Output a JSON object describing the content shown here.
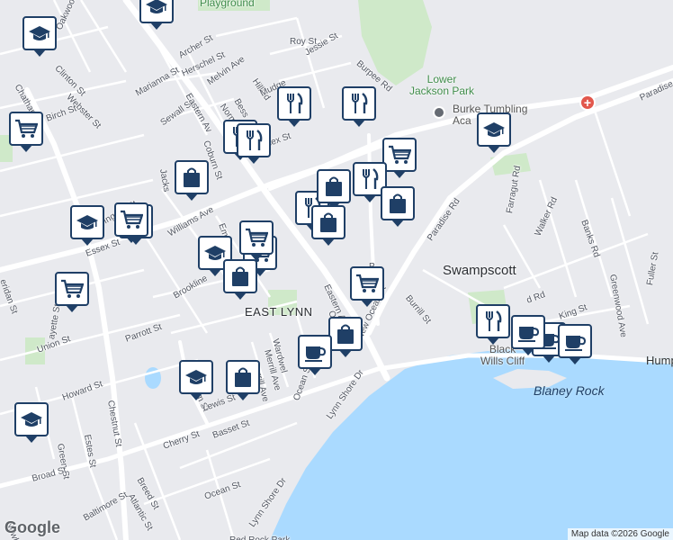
{
  "map": {
    "colors": {
      "land": "#e9eaee",
      "road": "#ffffff",
      "park": "#cfe9c9",
      "water": "#aadaff",
      "pin_border": "#1f3f66"
    },
    "places": [
      {
        "id": "swampscott",
        "text": "Swampscott"
      },
      {
        "id": "east-lynn",
        "text": "EAST LYNN"
      }
    ],
    "parks": [
      {
        "id": "playground",
        "text": "Playground"
      },
      {
        "id": "lower-jackson-park",
        "text": "Lower\nJackson Park"
      },
      {
        "id": "black-wills-cliff",
        "text": "Black\nWills Cliff"
      }
    ],
    "poi": [
      {
        "id": "burke-tumbling",
        "text": "Burke Tumbling\nAca"
      }
    ],
    "water_labels": [
      {
        "id": "blaney-rock",
        "text": "Blaney Rock"
      },
      {
        "id": "humphrey",
        "text": "Hump"
      }
    ],
    "streets": [
      {
        "id": "oakwood",
        "text": "Oakwood Av"
      },
      {
        "id": "clinton",
        "text": "Clinton St"
      },
      {
        "id": "webster",
        "text": "Webster St"
      },
      {
        "id": "birch",
        "text": "Birch St"
      },
      {
        "id": "chatham-n",
        "text": "Chatham"
      },
      {
        "id": "archer",
        "text": "Archer St"
      },
      {
        "id": "herschel",
        "text": "Herschel St"
      },
      {
        "id": "melvin",
        "text": "Melvin Ave"
      },
      {
        "id": "marianna",
        "text": "Marianna St"
      },
      {
        "id": "sewall",
        "text": "Sewall St"
      },
      {
        "id": "eastern-n",
        "text": "Eastern Av"
      },
      {
        "id": "norman",
        "text": "Norma"
      },
      {
        "id": "bessom",
        "text": "Bess"
      },
      {
        "id": "coburn",
        "text": "Coburn St"
      },
      {
        "id": "jackson",
        "text": "Jacks"
      },
      {
        "id": "hillside",
        "text": "Hillsid"
      },
      {
        "id": "mudge",
        "text": "Mudge"
      },
      {
        "id": "roy",
        "text": "Roy St"
      },
      {
        "id": "jessie",
        "text": "Jessie St"
      },
      {
        "id": "burpee",
        "text": "Burpee Rd"
      },
      {
        "id": "essex-n",
        "text": "Essex St"
      },
      {
        "id": "paradise-ne",
        "text": "Paradise"
      },
      {
        "id": "ingalls",
        "text": "Ingalls St"
      },
      {
        "id": "williams",
        "text": "Williams Ave"
      },
      {
        "id": "empire",
        "text": "Empire"
      },
      {
        "id": "tt",
        "text": "T"
      },
      {
        "id": "essex-w",
        "text": "Essex St"
      },
      {
        "id": "sheridan",
        "text": "eridan St"
      },
      {
        "id": "lafayette",
        "text": "ayette St"
      },
      {
        "id": "brookline",
        "text": "Brookline"
      },
      {
        "id": "parrott",
        "text": "Parrott St"
      },
      {
        "id": "union",
        "text": "Union St"
      },
      {
        "id": "paradise-rd",
        "text": "Paradise Rd"
      },
      {
        "id": "farragut",
        "text": "Farragut Rd"
      },
      {
        "id": "walker",
        "text": "Walker Rd"
      },
      {
        "id": "banks",
        "text": "Banks Rd"
      },
      {
        "id": "greenwood",
        "text": "Greenwood Ave"
      },
      {
        "id": "fuller",
        "text": "Fuller St"
      },
      {
        "id": "eastern-s",
        "text": "Eastern Av"
      },
      {
        "id": "new-ocean",
        "text": "New Ocean St"
      },
      {
        "id": "burrill-e",
        "text": "Burrill St"
      },
      {
        "id": "orchard",
        "text": "Orc"
      },
      {
        "id": "p",
        "text": "P"
      },
      {
        "id": "chatham-s",
        "text": "Chatham St"
      },
      {
        "id": "wardwell",
        "text": "Wardwel"
      },
      {
        "id": "merrill",
        "text": "Merrill Ave"
      },
      {
        "id": "burrill-ave",
        "text": "Burrill Ave"
      },
      {
        "id": "howard",
        "text": "Howard St"
      },
      {
        "id": "chestnut",
        "text": "Chestnut St"
      },
      {
        "id": "lewis",
        "text": "Lewis St"
      },
      {
        "id": "ocean-n",
        "text": "Ocean St"
      },
      {
        "id": "green",
        "text": "Green St"
      },
      {
        "id": "estes",
        "text": "Estes St"
      },
      {
        "id": "basset",
        "text": "Basset St"
      },
      {
        "id": "cherry",
        "text": "Cherry St"
      },
      {
        "id": "lynn-shore-1",
        "text": "Lynn Shore Dr"
      },
      {
        "id": "broad",
        "text": "Broad St"
      },
      {
        "id": "breed",
        "text": "Breed St"
      },
      {
        "id": "atlantic",
        "text": "Atlantic St"
      },
      {
        "id": "ocean-s",
        "text": "Ocean St"
      },
      {
        "id": "lynn-shore-2",
        "text": "Lynn Shore Dr"
      },
      {
        "id": "baltimore",
        "text": "Baltimore St"
      },
      {
        "id": "newh",
        "text": "Newh"
      },
      {
        "id": "king",
        "text": "King St"
      },
      {
        "id": "rd",
        "text": "d Rd"
      },
      {
        "id": "red-rock",
        "text": "Red Rock Park"
      }
    ],
    "markers": [
      {
        "type": "school"
      },
      {
        "type": "school"
      },
      {
        "type": "school"
      },
      {
        "type": "school"
      },
      {
        "type": "school"
      },
      {
        "type": "school"
      },
      {
        "type": "school"
      },
      {
        "type": "school"
      },
      {
        "type": "grocery"
      },
      {
        "type": "grocery"
      },
      {
        "type": "grocery"
      },
      {
        "type": "grocery"
      },
      {
        "type": "grocery"
      },
      {
        "type": "grocery"
      },
      {
        "type": "grocery"
      },
      {
        "type": "restaurant"
      },
      {
        "type": "restaurant"
      },
      {
        "type": "restaurant"
      },
      {
        "type": "restaurant"
      },
      {
        "type": "restaurant"
      },
      {
        "type": "restaurant"
      },
      {
        "type": "restaurant"
      },
      {
        "type": "shopping"
      },
      {
        "type": "shopping"
      },
      {
        "type": "shopping"
      },
      {
        "type": "shopping"
      },
      {
        "type": "shopping"
      },
      {
        "type": "shopping"
      },
      {
        "type": "shopping"
      },
      {
        "type": "cafe"
      },
      {
        "type": "cafe"
      },
      {
        "type": "cafe"
      },
      {
        "type": "cafe"
      }
    ],
    "hospital_symbol": "+",
    "logo": "Google",
    "attribution": "Map data ©2026 Google"
  }
}
